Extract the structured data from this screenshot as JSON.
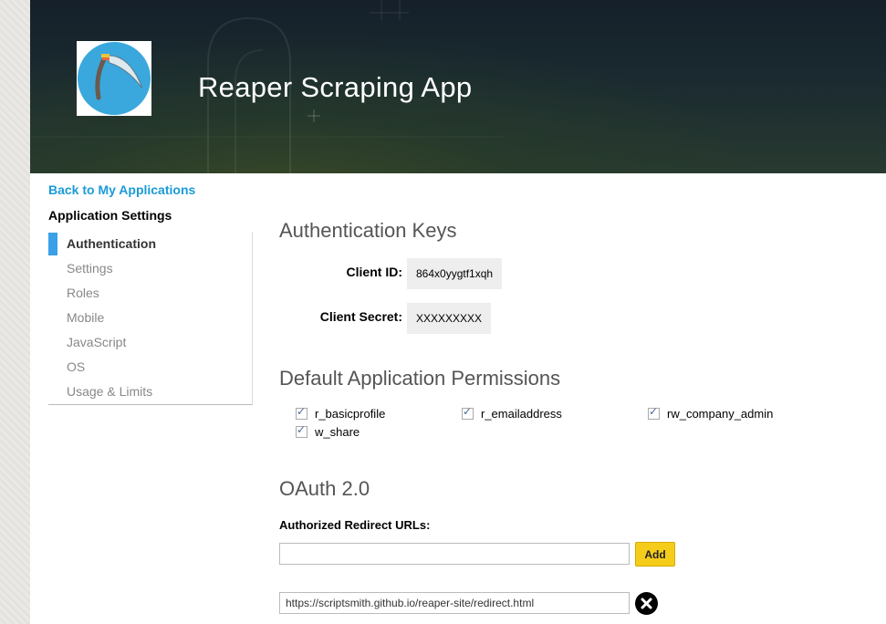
{
  "header": {
    "app_title": "Reaper Scraping App"
  },
  "sidebar": {
    "back_link": "Back to My Applications",
    "heading": "Application Settings",
    "items": [
      {
        "label": "Authentication",
        "active": true
      },
      {
        "label": "Settings"
      },
      {
        "label": "Roles"
      },
      {
        "label": "Mobile"
      },
      {
        "label": "JavaScript"
      },
      {
        "label": "OS"
      },
      {
        "label": "Usage & Limits"
      }
    ]
  },
  "auth_keys": {
    "title": "Authentication Keys",
    "client_id_label": "Client ID:",
    "client_id_value": "864x0yygtf1xqh",
    "client_secret_label": "Client Secret:",
    "client_secret_value": "XXXXXXXXX"
  },
  "permissions": {
    "title": "Default Application Permissions",
    "items": [
      {
        "label": "r_basicprofile",
        "checked": true
      },
      {
        "label": "r_emailaddress",
        "checked": true
      },
      {
        "label": "rw_company_admin",
        "checked": true
      },
      {
        "label": "w_share",
        "checked": true
      }
    ]
  },
  "oauth": {
    "title": "OAuth 2.0",
    "redirect_label": "Authorized Redirect URLs:",
    "new_url_value": "",
    "add_button": "Add",
    "urls": [
      "https://scriptsmith.github.io/reaper-site/redirect.html"
    ]
  },
  "colors": {
    "link": "#1a9bd7",
    "active_indicator": "#3aa0e8",
    "add_button": "#f5cc1a",
    "logo_circle": "#3aa8dc"
  },
  "icons": {
    "logo": "scythe-icon",
    "checkbox": "check-icon",
    "remove": "close-icon"
  }
}
